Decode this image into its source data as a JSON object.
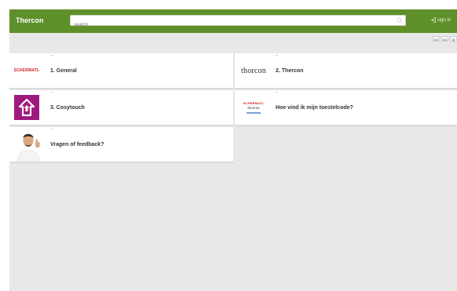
{
  "header": {
    "title": "Thercon",
    "search_placeholder": "search",
    "signin_label": "sign in"
  },
  "sizes": [
    "sm",
    "md",
    "lg"
  ],
  "cards": [
    {
      "logo_text": "SCHERMATL",
      "label": "1. General"
    },
    {
      "logo_text": "thorcon",
      "label": "2. Thercon"
    },
    {
      "label": "3. Cosytouch"
    },
    {
      "logo_text": "SCHERMATL",
      "logo_sub": "thorcon",
      "label": "Hoe vind ik mijn toestelcode?"
    },
    {
      "label": "Vragen of feedback?"
    }
  ],
  "colors": {
    "header": "#5f8f2a",
    "background": "#e8e8e8",
    "cosytouch": "#a0197f",
    "brand_red": "#d41a1a"
  }
}
